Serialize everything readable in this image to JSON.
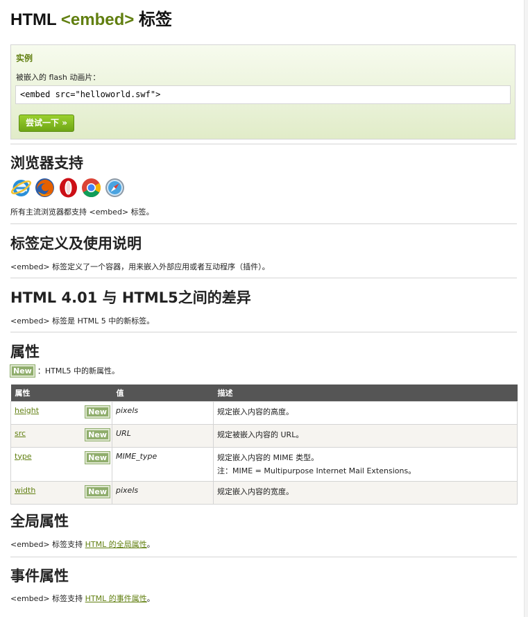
{
  "title": {
    "prefix": "HTML",
    "tag": "<embed>",
    "suffix": "标签"
  },
  "example": {
    "heading": "实例",
    "description": "被嵌入的 flash 动画片：",
    "code": "<embed src=\"helloworld.swf\">",
    "try_button": "尝试一下 »"
  },
  "browser_support": {
    "heading": "浏览器支持",
    "browsers": [
      "internet-explorer-icon",
      "firefox-icon",
      "opera-icon",
      "chrome-icon",
      "safari-icon"
    ],
    "text": "所有主流浏览器都支持 <embed> 标签。"
  },
  "definition": {
    "heading": "标签定义及使用说明",
    "text": "<embed> 标签定义了一个容器，用来嵌入外部应用或者互动程序（插件）。"
  },
  "differences": {
    "heading": "HTML 4.01 与 HTML5之间的差异",
    "text": "<embed> 标签是 HTML 5 中的新标签。"
  },
  "attributes": {
    "heading": "属性",
    "new_badge": "New",
    "new_note": "：HTML5 中的新属性。",
    "columns": [
      "属性",
      "值",
      "描述"
    ],
    "rows": [
      {
        "name": "height",
        "badge": "New",
        "value": "pixels",
        "desc": "规定嵌入内容的高度。",
        "desc2": ""
      },
      {
        "name": "src",
        "badge": "New",
        "value": "URL",
        "desc": "规定被嵌入内容的 URL。",
        "desc2": ""
      },
      {
        "name": "type",
        "badge": "New",
        "value": "MIME_type",
        "desc": "规定嵌入内容的 MIME 类型。",
        "desc2": "注：MIME = Multipurpose Internet Mail Extensions。"
      },
      {
        "name": "width",
        "badge": "New",
        "value": "pixels",
        "desc": "规定嵌入内容的宽度。",
        "desc2": ""
      }
    ]
  },
  "global": {
    "heading": "全局属性",
    "text_prefix": "<embed> 标签支持 ",
    "link": "HTML 的全局属性",
    "text_suffix": "。"
  },
  "events": {
    "heading": "事件属性",
    "text_prefix": "<embed> 标签支持 ",
    "link": "HTML 的事件属性",
    "text_suffix": "。"
  },
  "colors": {
    "accent": "#617f10",
    "button": "#7dbb1e",
    "table_header": "#555555",
    "badge": "#8fad6c"
  }
}
